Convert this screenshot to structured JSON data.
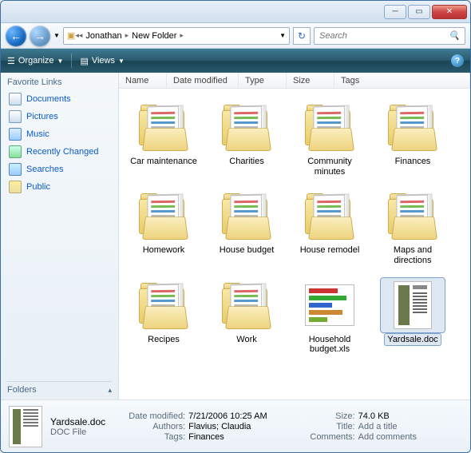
{
  "breadcrumb": {
    "seg1": "Jonathan",
    "seg2": "New Folder"
  },
  "search": {
    "placeholder": "Search"
  },
  "toolbar": {
    "organize": "Organize",
    "views": "Views"
  },
  "sidebar": {
    "heading": "Favorite Links",
    "items": [
      {
        "label": "Documents"
      },
      {
        "label": "Pictures"
      },
      {
        "label": "Music"
      },
      {
        "label": "Recently Changed"
      },
      {
        "label": "Searches"
      },
      {
        "label": "Public"
      }
    ],
    "folders_heading": "Folders"
  },
  "columns": {
    "name": "Name",
    "date": "Date modified",
    "type": "Type",
    "size": "Size",
    "tags": "Tags"
  },
  "items": [
    {
      "label": "Car maintenance",
      "kind": "folder"
    },
    {
      "label": "Charities",
      "kind": "folder"
    },
    {
      "label": "Community minutes",
      "kind": "folder"
    },
    {
      "label": "Finances",
      "kind": "folder"
    },
    {
      "label": "Homework",
      "kind": "folder"
    },
    {
      "label": "House budget",
      "kind": "folder"
    },
    {
      "label": "House remodel",
      "kind": "folder"
    },
    {
      "label": "Maps and directions",
      "kind": "folder"
    },
    {
      "label": "Recipes",
      "kind": "folder"
    },
    {
      "label": "Work",
      "kind": "folder"
    },
    {
      "label": "Household budget.xls",
      "kind": "xls"
    },
    {
      "label": "Yardsale.doc",
      "kind": "doc",
      "selected": true
    }
  ],
  "details": {
    "filename": "Yardsale.doc",
    "filetype": "DOC File",
    "rows": {
      "date_modified_label": "Date modified:",
      "date_modified": "7/21/2006 10:25 AM",
      "authors_label": "Authors:",
      "authors": "Flavius; Claudia",
      "tags_label": "Tags:",
      "tags": "Finances",
      "size_label": "Size:",
      "size": "74.0 KB",
      "title_label": "Title:",
      "title": "Add a title",
      "comments_label": "Comments:",
      "comments": "Add comments"
    }
  }
}
